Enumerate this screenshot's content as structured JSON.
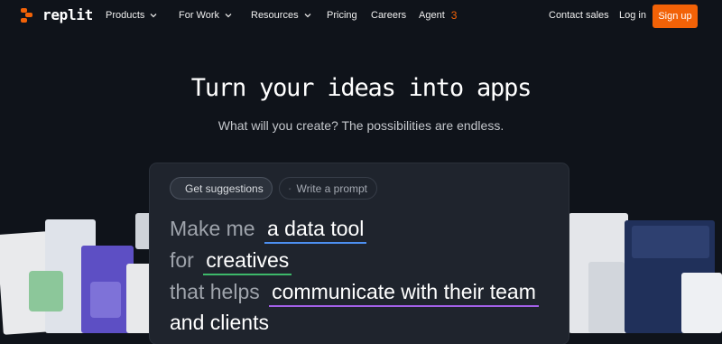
{
  "nav": {
    "logo_text": "replit",
    "products": "Products",
    "for_work": "For Work",
    "resources": "Resources",
    "pricing": "Pricing",
    "careers": "Careers",
    "agent": "Agent",
    "agent_version": "3",
    "contact_sales": "Contact sales",
    "log_in": "Log in",
    "sign_up": "Sign up"
  },
  "hero": {
    "title": "Turn your ideas into apps",
    "subtitle": "What will you create? The possibilities are endless."
  },
  "prompt": {
    "get_suggestions": "Get suggestions",
    "write_prompt": "Write a prompt",
    "line1_prefix": "Make me",
    "line1_value": "a data tool",
    "line2_prefix": "for",
    "line2_value": "creatives",
    "line3_prefix": "that helps",
    "line3_value": "communicate with their team",
    "line4": "and clients"
  },
  "colors": {
    "accent": "#f26207",
    "underline_blue": "#4d8ff0",
    "underline_green": "#3db86a",
    "underline_purple": "#a360e8"
  },
  "icons": [
    "shuffle-icon",
    "edit-icon",
    "chevron-down-icon"
  ]
}
